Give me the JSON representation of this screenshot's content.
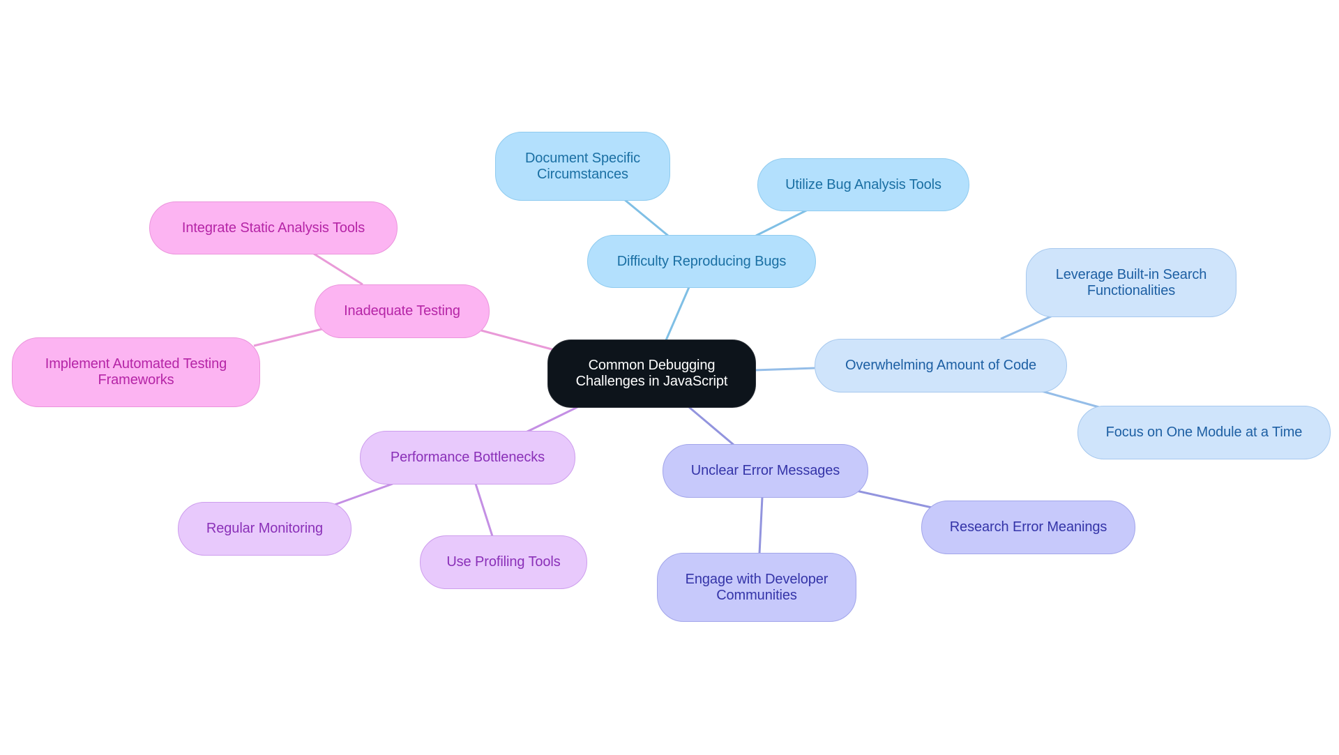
{
  "title": "Common Debugging Challenges in JavaScript",
  "colors": {
    "root": "#0d141b",
    "sky_edge": "#7fbfe5",
    "lblue_edge": "#94bde8",
    "indigo_edge": "#9294de",
    "violet_edge": "#c48fe4",
    "pink_edge": "#e99ad8"
  },
  "root": {
    "label": "Common Debugging Challenges in JavaScript",
    "lines": [
      "Common Debugging",
      "Challenges in JavaScript"
    ]
  },
  "branches": [
    {
      "label": "Difficulty Reproducing Bugs",
      "children": [
        {
          "label": "Document Specific Circumstances",
          "lines": [
            "Document Specific",
            "Circumstances"
          ]
        },
        {
          "label": "Utilize Bug Analysis Tools"
        }
      ]
    },
    {
      "label": "Overwhelming Amount of Code",
      "children": [
        {
          "label": "Leverage Built-in Search Functionalities",
          "lines": [
            "Leverage Built-in Search",
            "Functionalities"
          ]
        },
        {
          "label": "Focus on One Module at a Time"
        }
      ]
    },
    {
      "label": "Unclear Error Messages",
      "children": [
        {
          "label": "Research Error Meanings"
        },
        {
          "label": "Engage with Developer Communities",
          "lines": [
            "Engage with Developer",
            "Communities"
          ]
        }
      ]
    },
    {
      "label": "Performance Bottlenecks",
      "children": [
        {
          "label": "Regular Monitoring"
        },
        {
          "label": "Use Profiling Tools"
        }
      ]
    },
    {
      "label": "Inadequate Testing",
      "children": [
        {
          "label": "Integrate Static Analysis Tools"
        },
        {
          "label": "Implement Automated Testing Frameworks",
          "lines": [
            "Implement Automated Testing",
            "Frameworks"
          ]
        }
      ]
    }
  ]
}
